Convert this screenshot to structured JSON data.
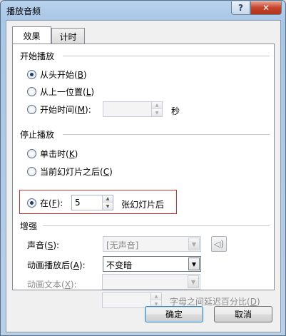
{
  "window": {
    "title": "播放音频"
  },
  "titlebar": {
    "help": "?",
    "close": "✕"
  },
  "tabs": [
    {
      "label": "效果"
    },
    {
      "label": "计时"
    }
  ],
  "start": {
    "heading": "开始播放",
    "opt1_text": "从头开始(",
    "opt1_key": "B",
    "opt1_end": ")",
    "opt2_text": "从上一位置(",
    "opt2_key": "L",
    "opt2_end": ")",
    "opt3_text": "开始时间(",
    "opt3_key": "M",
    "opt3_end": "):",
    "time_value": "",
    "time_unit": "秒",
    "selected": "opt1"
  },
  "stop": {
    "heading": "停止播放",
    "opt1_text": "单击时(",
    "opt1_key": "K",
    "opt1_end": ")",
    "opt2_text": "当前幻灯片之后(",
    "opt2_key": "C",
    "opt2_end": ")",
    "opt3_text": "在(",
    "opt3_key": "F",
    "opt3_end": "):",
    "after_value": "5",
    "after_unit": "张幻灯片后",
    "selected": "opt3"
  },
  "enhance": {
    "heading": "增强",
    "sound_label": "声音(",
    "sound_key": "S",
    "sound_end": "):",
    "sound_value": "[无声音]",
    "after_anim_label": "动画播放后(",
    "after_anim_key": "A",
    "after_anim_end": "):",
    "after_anim_value": "不变暗",
    "anim_text_label": "动画文本(",
    "anim_text_key": "X",
    "anim_text_end": "):",
    "anim_text_value": "",
    "delay_value": "",
    "delay_label": "字母之间延迟百分比(",
    "delay_key": "D",
    "delay_end": ")"
  },
  "buttons": {
    "ok": "确定",
    "cancel": "取消"
  }
}
